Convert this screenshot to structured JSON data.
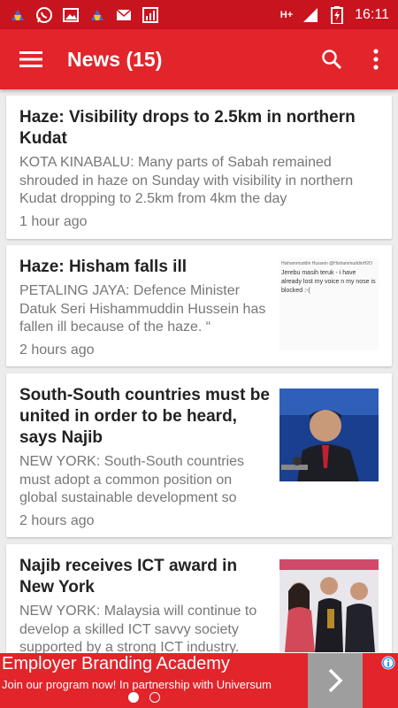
{
  "status_bar": {
    "time": "16:11",
    "network": "H+",
    "icons": [
      "cleaner-app-icon",
      "whatsapp-icon",
      "gallery-icon",
      "cleaner-app-icon",
      "email-icon",
      "chart-app-icon"
    ]
  },
  "app_bar": {
    "title": "News (15)",
    "menu_icon": "hamburger-menu-icon",
    "search_icon": "search-icon",
    "overflow_icon": "more-vert-icon"
  },
  "articles": [
    {
      "title": "Haze: Visibility drops to 2.5km in northern Kudat",
      "summary": "KOTA KINABALU: Many parts of Sabah remained shrouded in haze on Sunday with visibility in northern Kudat dropping to 2.5km from 4km the day",
      "time": "1 hour ago"
    },
    {
      "title": "Haze: Hisham falls ill",
      "summary": "PETALING JAYA: Defence Minister Datuk Seri Hishammuddin Hussein has fallen ill because of the haze. “",
      "time": "2 hours ago",
      "thumb": {
        "tweet_user": "Hishammuddin Hussein @HishammuddinH2O",
        "tweet_text": "Jerebu masih teruk - i have already lost my voice n my nose is blocked :-("
      }
    },
    {
      "title": "South-South countries must be united in order to be heard, says Najib",
      "summary": "NEW YORK: South-South countries must adopt a common position on global sustainable development so",
      "time": "2 hours ago"
    },
    {
      "title": "Najib receives ICT award in New York",
      "summary": "NEW YORK: Malaysia will continue to develop a skilled ICT savvy society supported by a strong ICT industry.",
      "time": ""
    }
  ],
  "ad": {
    "title": "Employer Branding Academy",
    "subtitle": "Join our program now! In partnership with Universum",
    "arrow_icon": "chevron-right-icon",
    "info_icon": "info-icon",
    "pages": 2,
    "active_page": 1
  },
  "colors": {
    "status_bar": "#c8141f",
    "app_bar": "#e2242b",
    "background": "#ececec",
    "title_text": "#222222",
    "secondary_text": "#777777"
  }
}
